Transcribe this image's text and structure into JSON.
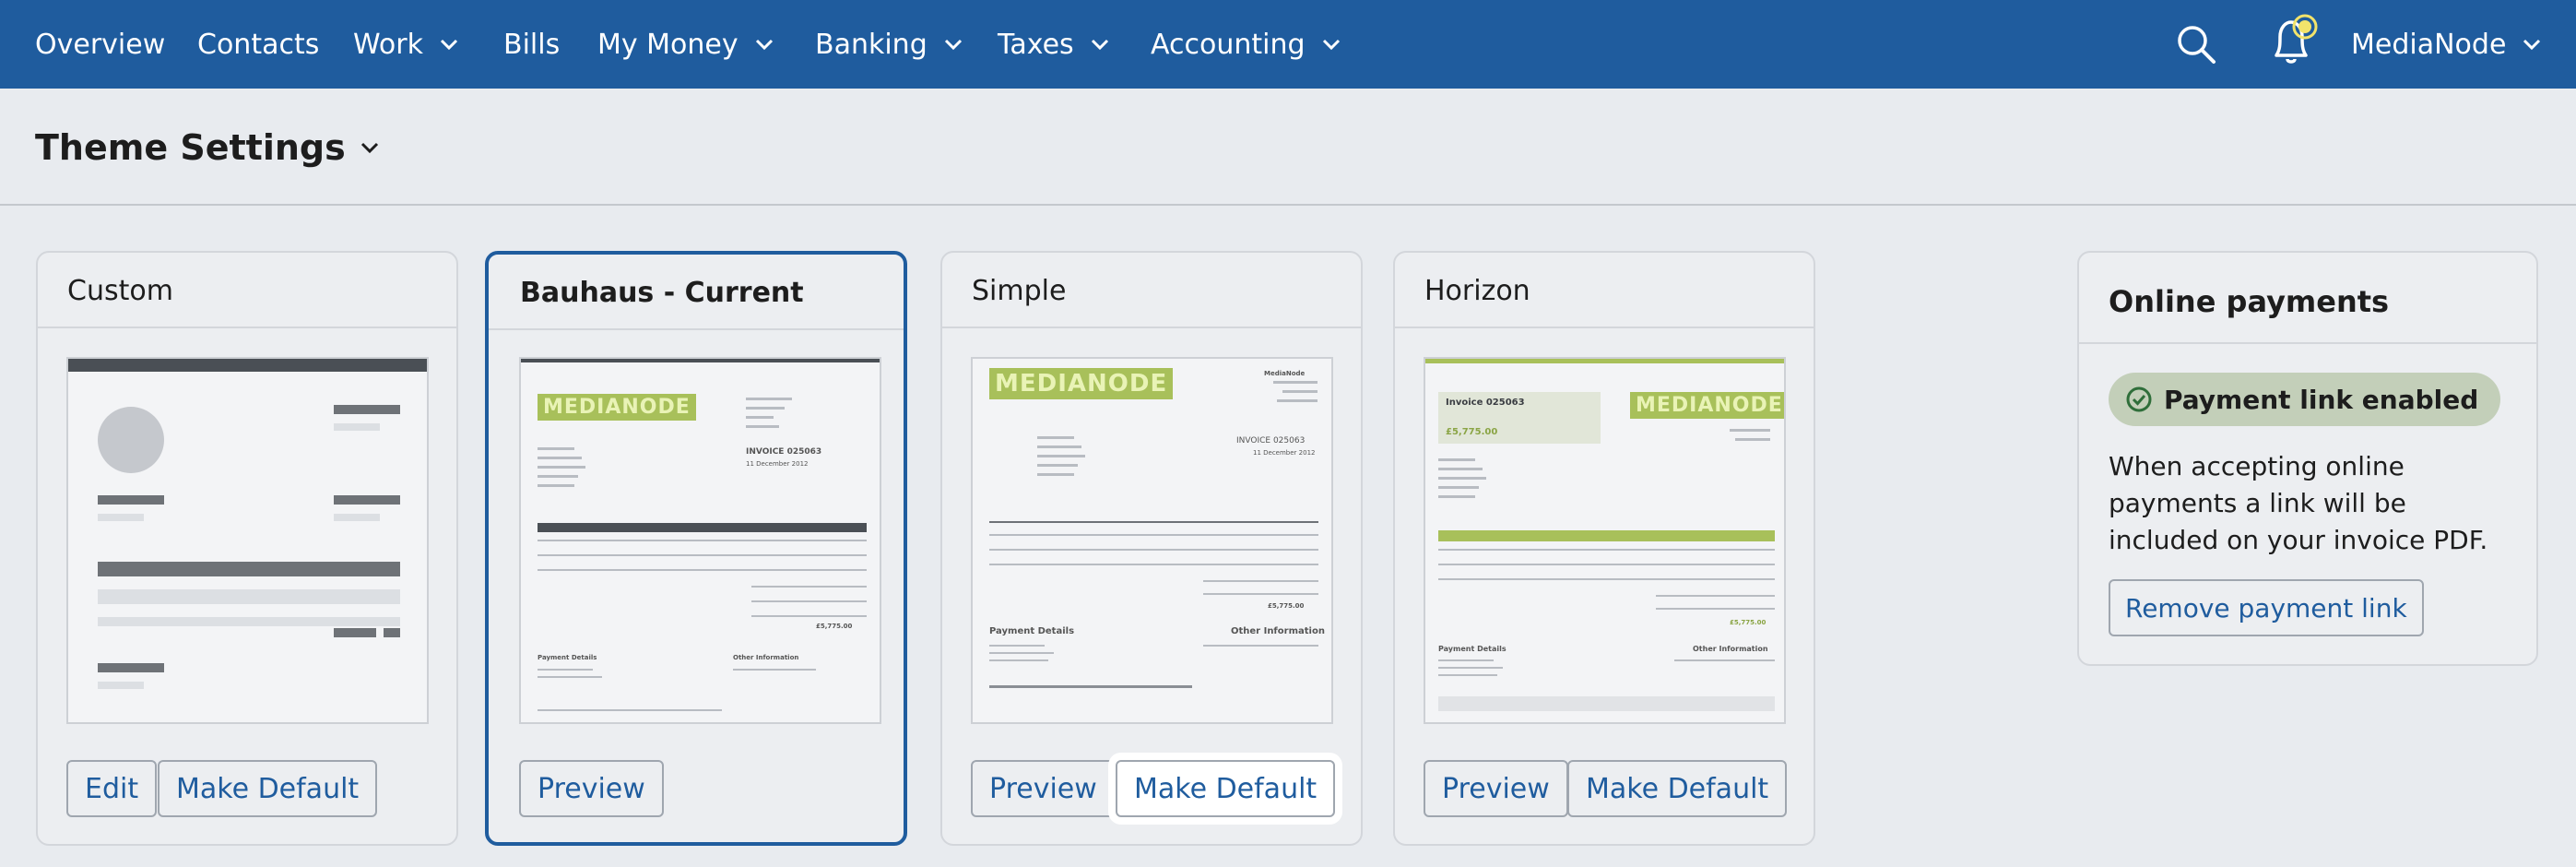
{
  "nav": {
    "items": [
      {
        "label": "Overview",
        "has_menu": false
      },
      {
        "label": "Contacts",
        "has_menu": false
      },
      {
        "label": "Work",
        "has_menu": true
      },
      {
        "label": "Bills",
        "has_menu": false
      },
      {
        "label": "My Money",
        "has_menu": true
      },
      {
        "label": "Banking",
        "has_menu": true
      },
      {
        "label": "Taxes",
        "has_menu": true
      },
      {
        "label": "Accounting",
        "has_menu": true
      }
    ],
    "account_label": "MediaNode",
    "icons": [
      "search-icon",
      "bell-icon",
      "chevron-down-icon"
    ],
    "colors": {
      "bar": "#1f5c9e",
      "notification_dot": "#f2e36b"
    }
  },
  "header": {
    "title": "Theme Settings"
  },
  "themes": [
    {
      "name": "Custom",
      "current": false,
      "buttons": [
        "Edit",
        "Make Default"
      ]
    },
    {
      "name": "Bauhaus - Current",
      "current": true,
      "buttons": [
        "Preview"
      ],
      "preview": {
        "logo": "MEDIANODE",
        "invoice_no": "INVOICE 025063",
        "date": "11 December 2012",
        "total": "£5,775.00",
        "payment_details": "Payment Details",
        "other_info": "Other Information"
      }
    },
    {
      "name": "Simple",
      "current": false,
      "buttons": [
        "Preview",
        "Make Default"
      ],
      "preview": {
        "logo": "MEDIANODE",
        "company": "MediaNode",
        "invoice_no": "INVOICE 025063",
        "date": "11 December 2012",
        "total": "£5,775.00",
        "payment_details": "Payment Details",
        "other_info": "Other Information"
      }
    },
    {
      "name": "Horizon",
      "current": false,
      "buttons": [
        "Preview",
        "Make Default"
      ],
      "preview": {
        "logo": "MEDIANODE",
        "invoice_no": "Invoice 025063",
        "amount": "£5,775.00",
        "total": "£5,775.00",
        "payment_details": "Payment Details",
        "other_info": "Other Information"
      }
    }
  ],
  "payments": {
    "title": "Online payments",
    "status": "Payment link enabled",
    "description": "When accepting online payments a link will be included on your invoice PDF.",
    "button": "Remove payment link",
    "status_color": "#c3cfb9"
  },
  "colors": {
    "accent": "#1f5c9e",
    "background": "#e8ebef",
    "logo_green": "#a8c05a"
  }
}
